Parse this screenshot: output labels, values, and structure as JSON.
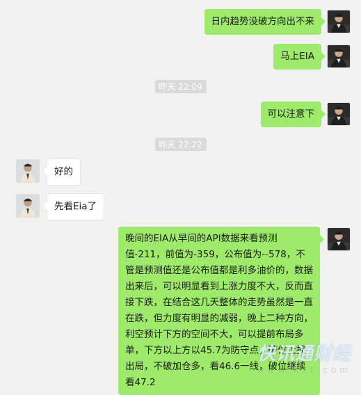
{
  "messages": [
    {
      "text": "日内趋势没破方向出不来"
    },
    {
      "text": "马上EIA"
    },
    {
      "text": "可以注意下"
    },
    {
      "text": "好的"
    },
    {
      "text": "先看Eia了"
    },
    {
      "text": "晚间的EIA从早间的API数据来看预测值-211，前值为-359，公布值为--578，不管是预测值还是公布值都是利多油价的，数据出来后，可以明显看到上涨力度不大，反而直接下跌，在结合这几天整体的走势虽然是一直在跌，但力度有明显的减弱，晚上二种方向，利空预计下方的空间不大，可以提前布局多单，下方以上方以45.7为防守点，破位止损出局，不破加仓多，看46.6一线，破位继续看47.2"
    }
  ],
  "timestamps": [
    "昨天 22:09",
    "昨天 22:22"
  ],
  "watermark": {
    "brand": "快讯通财经",
    "url": "www.kxt.com"
  },
  "colors": {
    "background": "#f2f2f2",
    "my_bubble": "#9eea6a",
    "other_bubble": "#ffffff",
    "time_chip": "#dadada"
  }
}
